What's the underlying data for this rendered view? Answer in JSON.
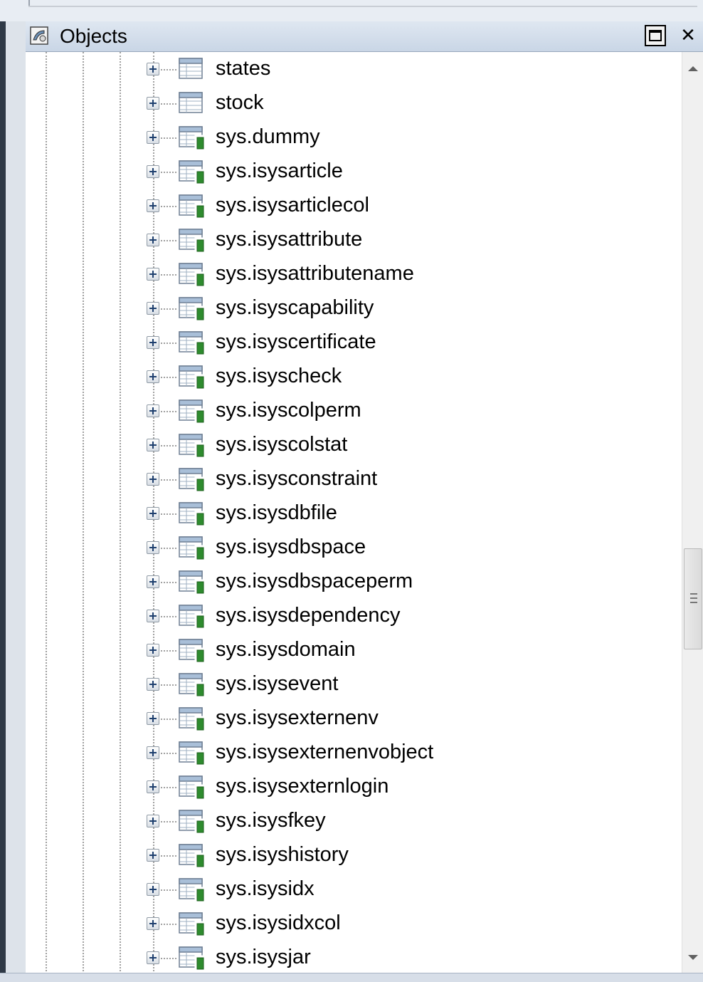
{
  "panel": {
    "title": "Objects",
    "icon": "objects-panel-icon",
    "maximize_icon": "maximize-icon",
    "close_icon": "close-icon",
    "close_glyph": "✕"
  },
  "tree": {
    "items": [
      {
        "label": "states",
        "icon": "table-icon",
        "system": false
      },
      {
        "label": "stock",
        "icon": "table-icon",
        "system": false
      },
      {
        "label": "sys.dummy",
        "icon": "system-table-icon",
        "system": true
      },
      {
        "label": "sys.isysarticle",
        "icon": "system-table-icon",
        "system": true
      },
      {
        "label": "sys.isysarticlecol",
        "icon": "system-table-icon",
        "system": true
      },
      {
        "label": "sys.isysattribute",
        "icon": "system-table-icon",
        "system": true
      },
      {
        "label": "sys.isysattributename",
        "icon": "system-table-icon",
        "system": true
      },
      {
        "label": "sys.isyscapability",
        "icon": "system-table-icon",
        "system": true
      },
      {
        "label": "sys.isyscertificate",
        "icon": "system-table-icon",
        "system": true
      },
      {
        "label": "sys.isyscheck",
        "icon": "system-table-icon",
        "system": true
      },
      {
        "label": "sys.isyscolperm",
        "icon": "system-table-icon",
        "system": true
      },
      {
        "label": "sys.isyscolstat",
        "icon": "system-table-icon",
        "system": true
      },
      {
        "label": "sys.isysconstraint",
        "icon": "system-table-icon",
        "system": true
      },
      {
        "label": "sys.isysdbfile",
        "icon": "system-table-icon",
        "system": true
      },
      {
        "label": "sys.isysdbspace",
        "icon": "system-table-icon",
        "system": true
      },
      {
        "label": "sys.isysdbspaceperm",
        "icon": "system-table-icon",
        "system": true
      },
      {
        "label": "sys.isysdependency",
        "icon": "system-table-icon",
        "system": true
      },
      {
        "label": "sys.isysdomain",
        "icon": "system-table-icon",
        "system": true
      },
      {
        "label": "sys.isysevent",
        "icon": "system-table-icon",
        "system": true
      },
      {
        "label": "sys.isysexternenv",
        "icon": "system-table-icon",
        "system": true
      },
      {
        "label": "sys.isysexternenvobject",
        "icon": "system-table-icon",
        "system": true
      },
      {
        "label": "sys.isysexternlogin",
        "icon": "system-table-icon",
        "system": true
      },
      {
        "label": "sys.isysfkey",
        "icon": "system-table-icon",
        "system": true
      },
      {
        "label": "sys.isyshistory",
        "icon": "system-table-icon",
        "system": true
      },
      {
        "label": "sys.isysidx",
        "icon": "system-table-icon",
        "system": true
      },
      {
        "label": "sys.isysidxcol",
        "icon": "system-table-icon",
        "system": true
      },
      {
        "label": "sys.isysjar",
        "icon": "system-table-icon",
        "system": true
      }
    ]
  },
  "scrollbar": {
    "up_icon": "scroll-up-arrow-icon",
    "down_icon": "scroll-down-arrow-icon"
  },
  "colors": {
    "header_bg": "#c9d6e6",
    "tree_bg": "#ffffff",
    "system_table_accent": "#2e8b2e"
  }
}
